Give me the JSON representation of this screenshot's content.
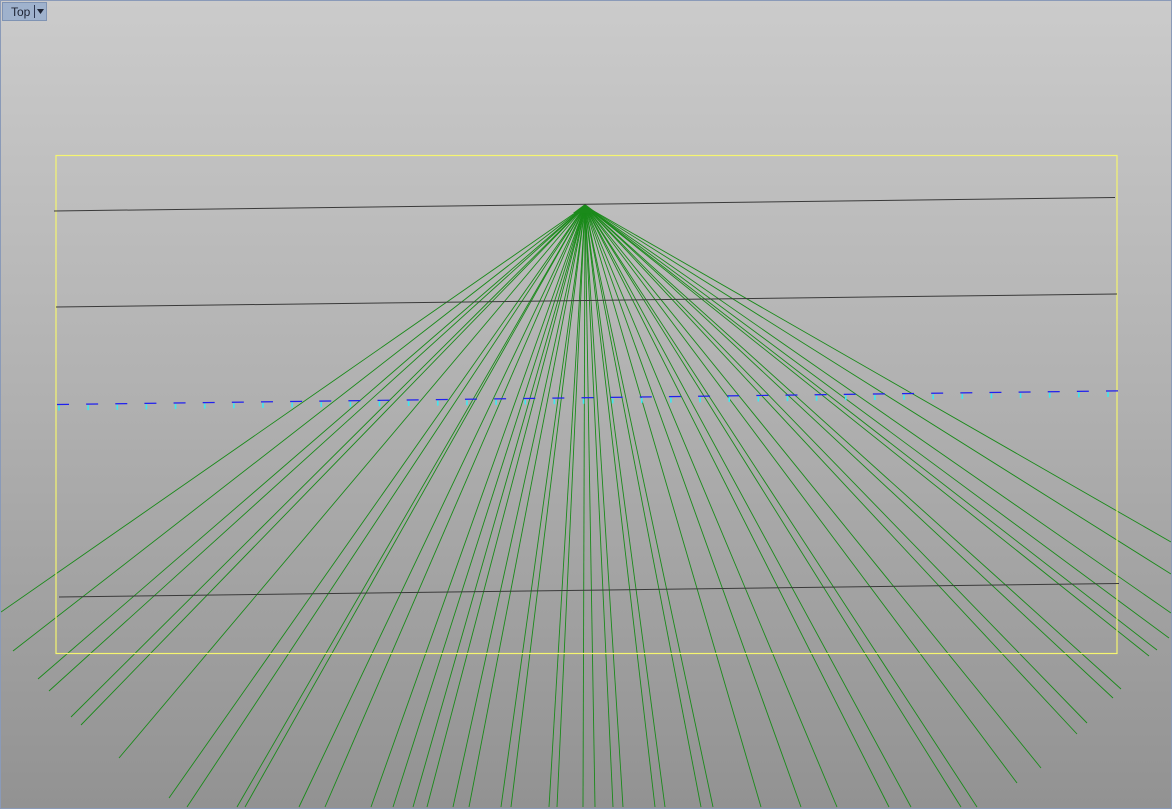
{
  "viewport": {
    "label": "Top",
    "dropdown_icon": "triangle-down-icon"
  },
  "colors": {
    "rays": "#1a8a1a",
    "frame": "#f5f570",
    "guide_lines": "#3a3a3a",
    "dash_blue": "#2020ee",
    "tick_cyan": "#40e8f0",
    "label_bg": "#9fb2cd"
  }
}
